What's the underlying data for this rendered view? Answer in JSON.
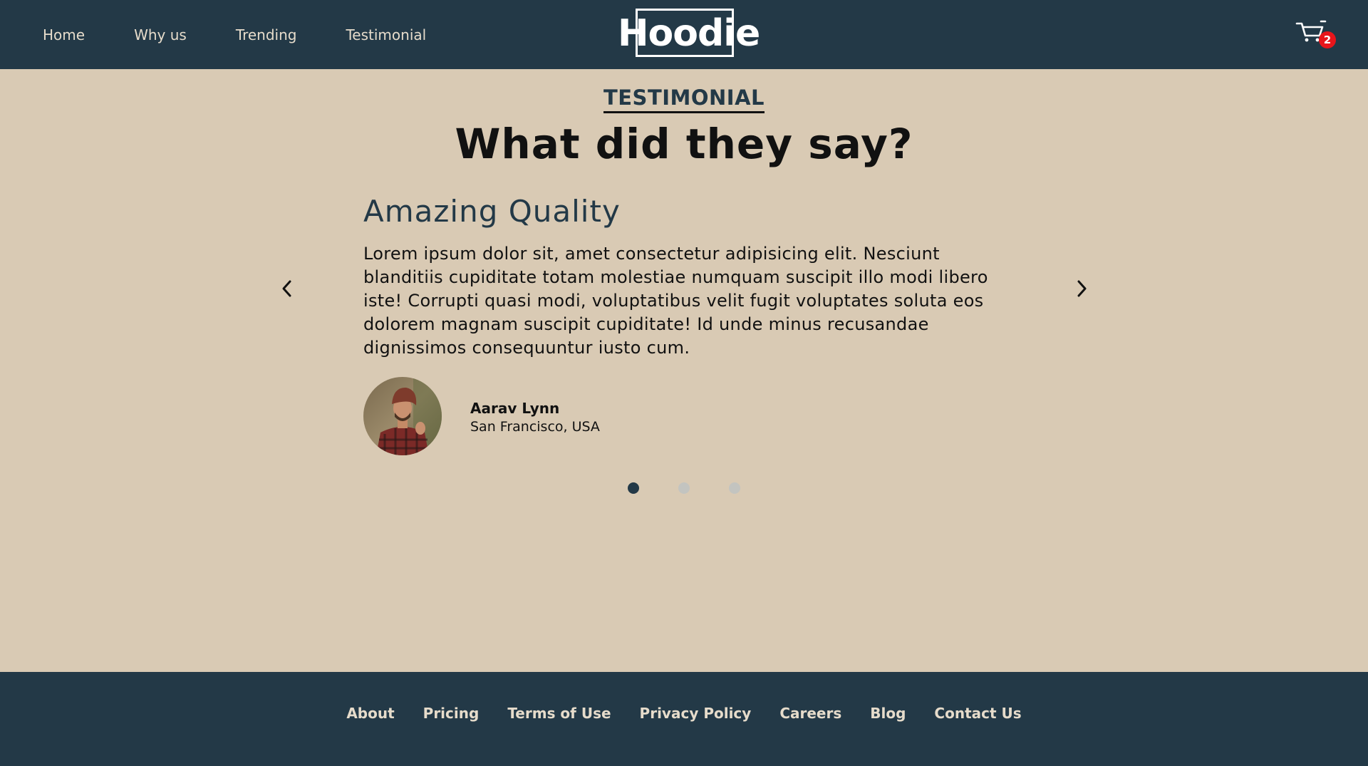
{
  "header": {
    "nav": [
      "Home",
      "Why us",
      "Trending",
      "Testimonial"
    ],
    "logo_text": "Hoodie",
    "cart_icon": "cart-icon",
    "cart_count": "2"
  },
  "section": {
    "kicker": "TESTIMONIAL",
    "title": "What did they say?"
  },
  "testimonial": {
    "heading": "Amazing Quality",
    "body": "Lorem ipsum dolor sit, amet consectetur adipisicing elit. Nesciunt blanditiis cupiditate totam molestiae numquam suscipit illo modi libero iste! Corrupti quasi modi, voluptatibus velit fugit voluptates soluta eos dolorem magnam suscipit cupiditate! Id unde minus recusandae dignissimos consequuntur iusto cum.",
    "author_name": "Aarav Lynn",
    "author_location": "San Francisco, USA",
    "prev_icon": "chevron-left-icon",
    "next_icon": "chevron-right-icon"
  },
  "carousel": {
    "slides": 3,
    "active_index": 0
  },
  "colors": {
    "header_bg": "#233947",
    "page_bg": "#d9cab4",
    "nav_text": "#e6dccb",
    "badge": "#e8151b",
    "dot_active": "#233947",
    "dot_inactive": "#c3c4c0"
  },
  "footer": {
    "links": [
      "About",
      "Pricing",
      "Terms of Use",
      "Privacy Policy",
      "Careers",
      "Blog",
      "Contact Us"
    ]
  }
}
